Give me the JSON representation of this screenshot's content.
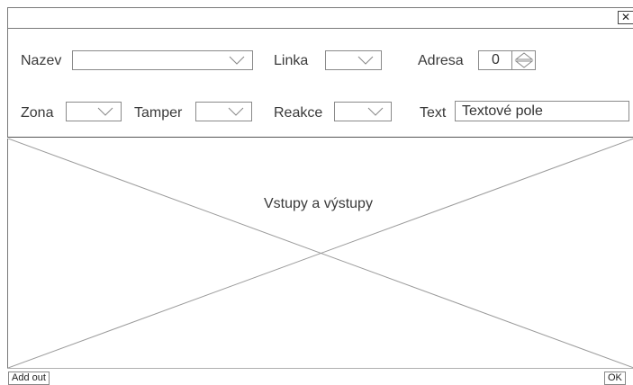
{
  "titlebar": {
    "close_icon": "close-icon",
    "close_glyph": "✕"
  },
  "form": {
    "nazev": {
      "label": "Nazev",
      "value": ""
    },
    "linka": {
      "label": "Linka",
      "value": ""
    },
    "adresa": {
      "label": "Adresa",
      "value": "0"
    },
    "zona": {
      "label": "Zona",
      "value": ""
    },
    "tamper": {
      "label": "Tamper",
      "value": ""
    },
    "reakce": {
      "label": "Reakce",
      "value": ""
    },
    "text": {
      "label": "Text",
      "value": "Textové pole"
    }
  },
  "placeholder": {
    "label": "Vstupy a výstupy"
  },
  "footer": {
    "add_out": "Add out",
    "ok": "OK"
  }
}
